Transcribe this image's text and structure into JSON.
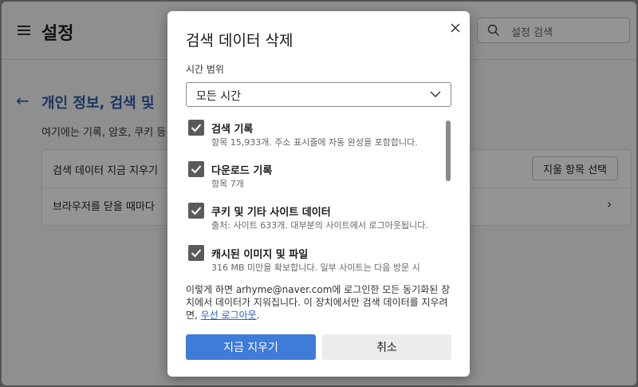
{
  "settings_page": {
    "title": "설정",
    "search_placeholder": "설정 검색",
    "section_title": "개인 정보, 검색 및",
    "section_desc": "여기에는 기록, 암호, 쿠키 등",
    "rows": {
      "clear_now_label": "검색 데이터 지금 지우기",
      "choose_button": "지울 항목 선택",
      "on_close_label": "브라우저를 닫을 때마다"
    }
  },
  "dialog": {
    "title": "검색 데이터 삭제",
    "time_range_label": "시간 범위",
    "time_range_value": "모든 시간",
    "items": [
      {
        "title": "검색 기록",
        "desc": "항목 15,933개. 주소 표시줄에 자동 완성을 포함합니다.",
        "checked": true
      },
      {
        "title": "다운로드 기록",
        "desc": "항목 7개",
        "checked": true
      },
      {
        "title": "쿠키 및 기타 사이트 데이터",
        "desc": "출처: 사이트 633개. 대부분의 사이트에서 로그아웃됩니다.",
        "checked": true
      },
      {
        "title": "캐시된 이미지 및 파일",
        "desc": "316 MB 미만을 확보합니다. 일부 사이트는 다음 방문 시",
        "checked": true
      }
    ],
    "notice_text": "이렇게 하면 arhyme@naver.com에 로그인한 모든 동기화된 장치에서 데이터가 지워집니다. 이 장치에서만 검색 데이터를 지우려면, ",
    "notice_link": "우선 로그아웃",
    "notice_end": ".",
    "clear_button": "지금 지우기",
    "cancel_button": "취소"
  },
  "colors": {
    "accent": "#3f7bd8",
    "link": "#2a63b8",
    "section_title": "#2b5da8"
  }
}
